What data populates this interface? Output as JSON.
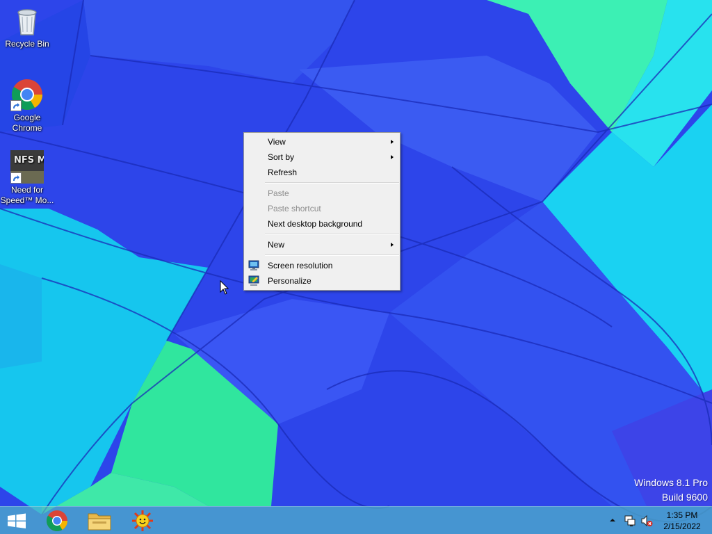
{
  "desktop": {
    "icons": [
      {
        "label": "Recycle Bin",
        "icon": "recycle-bin-icon"
      },
      {
        "label": "Google Chrome",
        "icon": "chrome-icon"
      },
      {
        "label": "Need for Speed™ Mo...",
        "icon": "nfs-most-wanted-icon",
        "badge": "NFS MW"
      }
    ]
  },
  "context_menu": {
    "items": [
      {
        "label": "View",
        "submenu": true,
        "enabled": true
      },
      {
        "label": "Sort by",
        "submenu": true,
        "enabled": true
      },
      {
        "label": "Refresh",
        "enabled": true
      },
      {
        "label": "Paste",
        "enabled": false
      },
      {
        "label": "Paste shortcut",
        "enabled": false
      },
      {
        "label": "Next desktop background",
        "enabled": true
      },
      {
        "label": "New",
        "submenu": true,
        "enabled": true
      },
      {
        "label": "Screen resolution",
        "enabled": true,
        "icon": "screen-resolution-icon"
      },
      {
        "label": "Personalize",
        "enabled": true,
        "icon": "personalize-icon"
      }
    ]
  },
  "watermark": {
    "line1": "Windows 8.1 Pro",
    "line2": "Build 9600"
  },
  "taskbar": {
    "pinned": [
      {
        "name": "start-button",
        "icon": "windows-logo-icon"
      },
      {
        "name": "chrome",
        "icon": "chrome-icon"
      },
      {
        "name": "file-explorer",
        "icon": "folder-icon"
      },
      {
        "name": "sun-app",
        "icon": "sun-icon"
      }
    ],
    "tray": {
      "icons": [
        "show-hidden-icons-arrow",
        "network-icon",
        "volume-muted-icon"
      ],
      "time": "1:35 PM",
      "date": "2/15/2022"
    }
  },
  "colors": {
    "menu_bg": "#f0f0f0",
    "menu_disabled_text": "#8d8d8d",
    "taskbar_tint": "#50b4c8",
    "wallpaper_primary": "#2a3fe8",
    "wallpaper_cyan": "#1ec8f0",
    "wallpaper_green": "#36e6a0"
  }
}
